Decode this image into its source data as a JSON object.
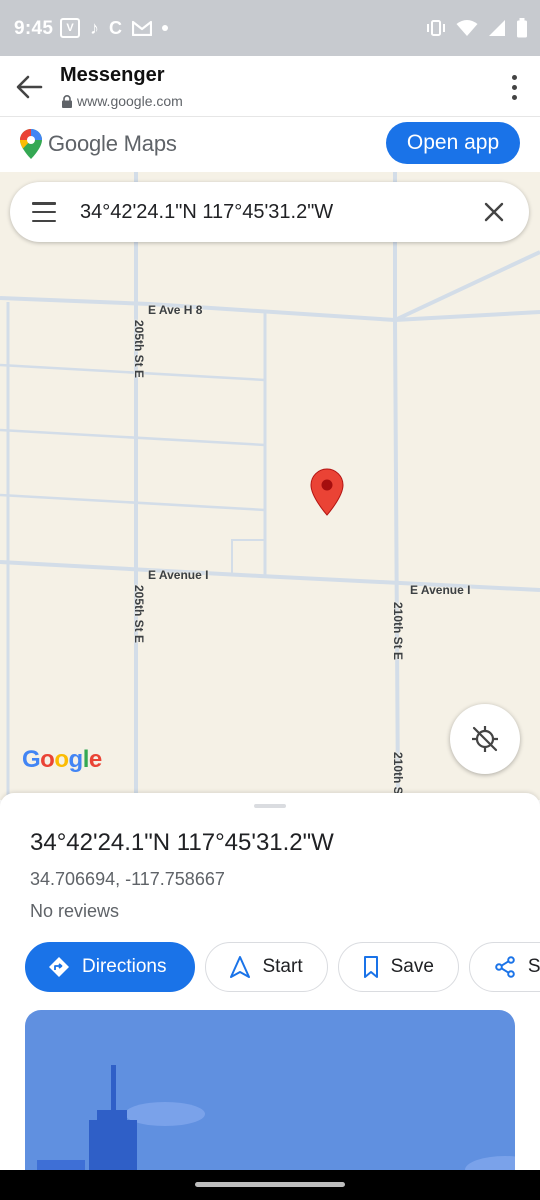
{
  "status_bar": {
    "time": "9:45",
    "notification_icons": [
      "vpn-icon",
      "tiktok-icon",
      "c-app-icon",
      "gmail-icon",
      "dot-icon"
    ],
    "system_icons": [
      "vibrate-icon",
      "wifi-icon",
      "signal-icon",
      "battery-icon"
    ]
  },
  "custom_tab": {
    "title": "Messenger",
    "url": "www.google.com"
  },
  "maps_header": {
    "logo_text": "Google Maps",
    "open_app_label": "Open app"
  },
  "search": {
    "query": "34°42'24.1\"N 117°45'31.2\"W"
  },
  "map": {
    "road_labels": {
      "ave_h8": "E Ave H 8",
      "st205_top": "205th St E",
      "avenue_i_left": "E Avenue I",
      "avenue_i_right": "E Avenue I",
      "st205_bottom": "205th St E",
      "st210": "210th St E",
      "st210_bottom": "210th S"
    },
    "attribution": "Google"
  },
  "place": {
    "title": "34°42'24.1\"N 117°45'31.2\"W",
    "coordinates": "34.706694, -117.758667",
    "reviews": "No reviews"
  },
  "actions": {
    "directions": "Directions",
    "start": "Start",
    "save": "Save",
    "share": "Share"
  },
  "colors": {
    "accent": "#1a73e8",
    "map_bg": "#f5f1e6",
    "road": "#d3dde8",
    "pin": "#ea4335"
  }
}
